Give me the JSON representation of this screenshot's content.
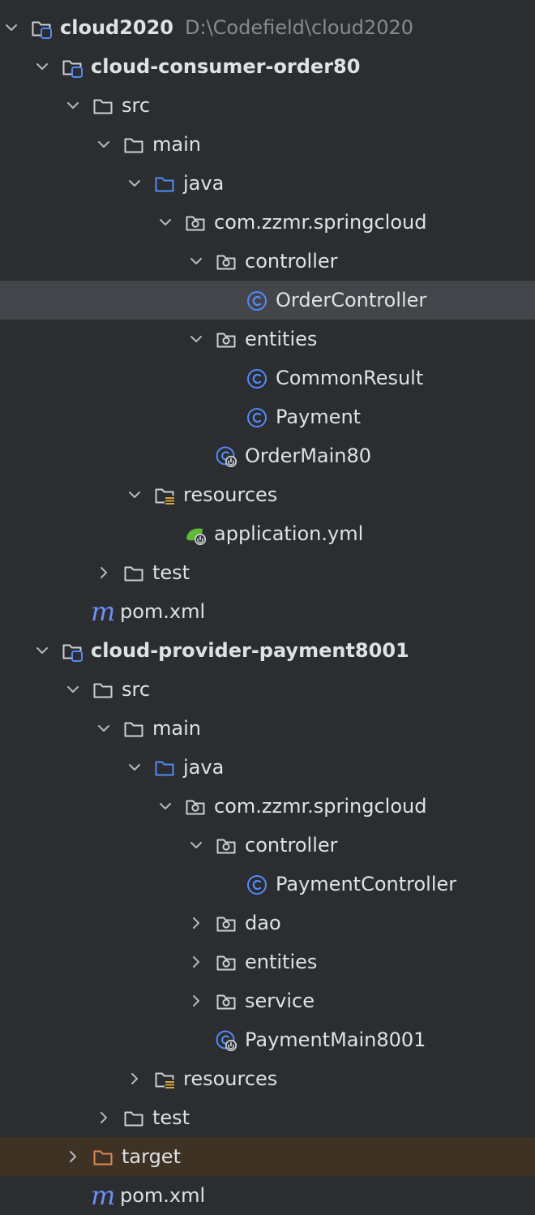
{
  "project_tree": {
    "root": {
      "label": "cloud2020",
      "path": "D:\\Codefield\\cloud2020"
    },
    "modules": [
      {
        "label": "cloud-consumer-order80",
        "src": "src",
        "main": "main",
        "java": "java",
        "package": "com.zzmr.springcloud",
        "controller_folder": "controller",
        "controller_class": "OrderController",
        "entities_folder": "entities",
        "entity_classes": [
          "CommonResult",
          "Payment"
        ],
        "main_class": "OrderMain80",
        "resources": "resources",
        "config_file": "application.yml",
        "test": "test",
        "pom": "pom.xml"
      },
      {
        "label": "cloud-provider-payment8001",
        "src": "src",
        "main": "main",
        "java": "java",
        "package": "com.zzmr.springcloud",
        "controller_folder": "controller",
        "controller_class": "PaymentController",
        "dao_folder": "dao",
        "entities_folder": "entities",
        "service_folder": "service",
        "main_class": "PaymentMain8001",
        "resources": "resources",
        "test": "test",
        "target": "target",
        "pom": "pom.xml"
      }
    ],
    "selected_item": "OrderController"
  },
  "colors": {
    "background": "#2b2d30",
    "selection": "#43454a",
    "excluded_row": "#3d3223",
    "text": "#dfe1e5",
    "muted_text": "#868a91",
    "folder": "#ced0d6",
    "source_folder": "#548af7",
    "class_icon": "#548af7",
    "excluded_folder": "#e08855",
    "spring_green": "#5fb832",
    "maven": "#6c8ff5"
  },
  "icons": {
    "expanded": "chevron-down-icon",
    "collapsed": "chevron-right-icon",
    "module": "module-folder-icon",
    "folder": "folder-icon",
    "source_root": "source-root-folder-icon",
    "package": "package-folder-icon",
    "resources": "resources-folder-icon",
    "excluded": "excluded-folder-icon",
    "class": "java-class-icon",
    "main_class": "spring-boot-main-class-icon",
    "yaml": "spring-config-icon",
    "maven": "maven-pom-icon"
  }
}
